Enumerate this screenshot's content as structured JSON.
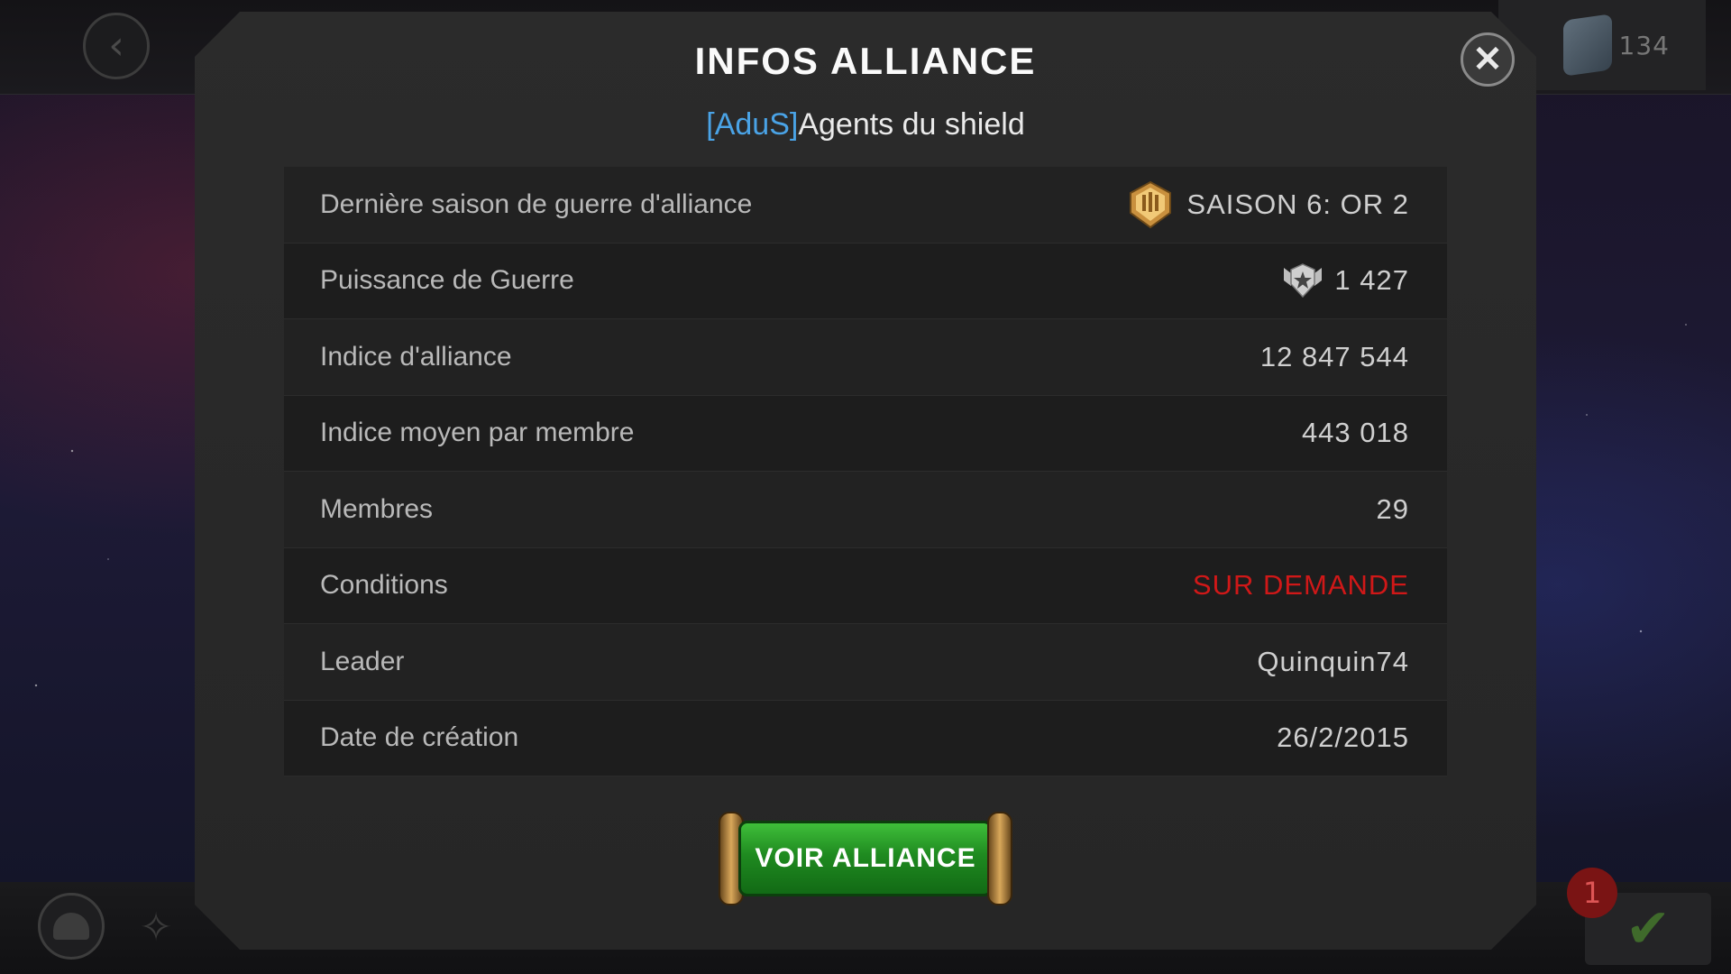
{
  "top_bar": {
    "currency_value": "134"
  },
  "bottom_bar": {
    "notification_count": "1"
  },
  "modal": {
    "title": "INFOS ALLIANCE",
    "alliance_tag": "[AduS]",
    "alliance_name": "Agents du shield",
    "rows": [
      {
        "label": "Dernière saison de guerre d'alliance",
        "value": "SAISON 6: OR 2",
        "icon": "season-badge-icon"
      },
      {
        "label": "Puissance de Guerre",
        "value": "1 427",
        "icon": "war-rating-icon"
      },
      {
        "label": "Indice d'alliance",
        "value": "12 847 544"
      },
      {
        "label": "Indice moyen par membre",
        "value": "443 018"
      },
      {
        "label": "Membres",
        "value": "29"
      },
      {
        "label": "Conditions",
        "value": "SUR DEMANDE",
        "color": "#d01818"
      },
      {
        "label": "Leader",
        "value": "Quinquin74"
      },
      {
        "label": "Date de création",
        "value": "26/2/2015"
      }
    ],
    "button_label": "VOIR ALLIANCE"
  },
  "colors": {
    "tag": "#4aa3e6",
    "warning": "#d01818",
    "button_green": "#1f8a20"
  }
}
